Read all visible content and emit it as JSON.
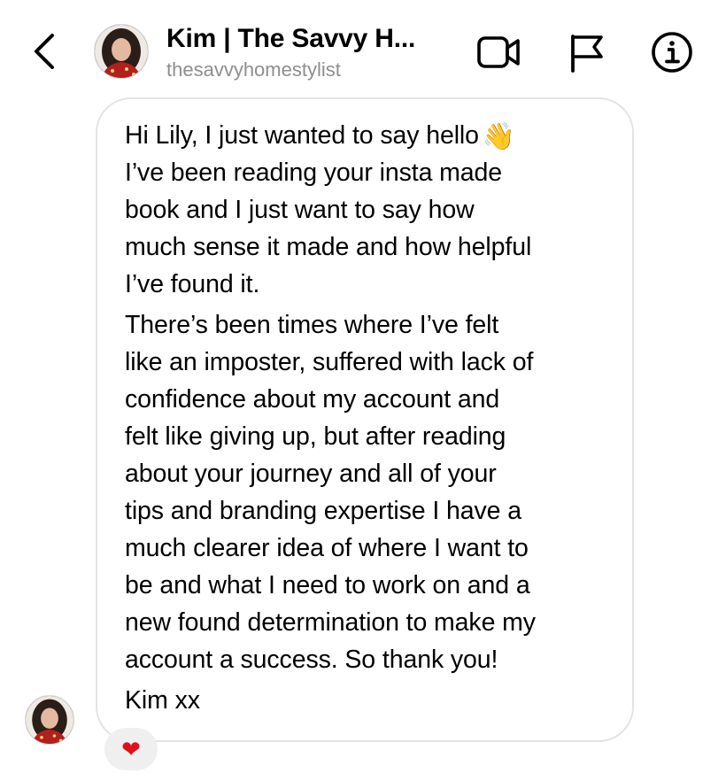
{
  "header": {
    "back_icon": "chevron-left-icon",
    "contact_name": "Kim | The Savvy H...",
    "contact_handle": "thesavvyhomestylist",
    "actions": {
      "video_icon": "video-camera-icon",
      "flag_icon": "flag-icon",
      "info_icon": "info-icon"
    }
  },
  "message": {
    "lines": [
      "Hi Lily, I just wanted to say hello",
      "I’ve been reading your insta made",
      "book and I just want to say how",
      "much sense it made and how helpful",
      "I’ve found it.",
      "There’s been times where I’ve felt",
      "like an imposter, suffered with lack of",
      "confidence about my account and",
      "felt like giving up, but after reading",
      "about your journey and all of your",
      "tips and branding expertise I have a",
      "much clearer idea of where I want to",
      "be and what I need to work on and a",
      "new found determination to make my",
      "account a success. So thank you!",
      "Kim xx"
    ],
    "wave_emoji": "👋",
    "reaction": "❤"
  },
  "colors": {
    "secondary_text": "#8e8e8e",
    "bubble_border": "#e3e3e3",
    "reaction_bg": "#efefef",
    "heart": "#e0101a"
  }
}
